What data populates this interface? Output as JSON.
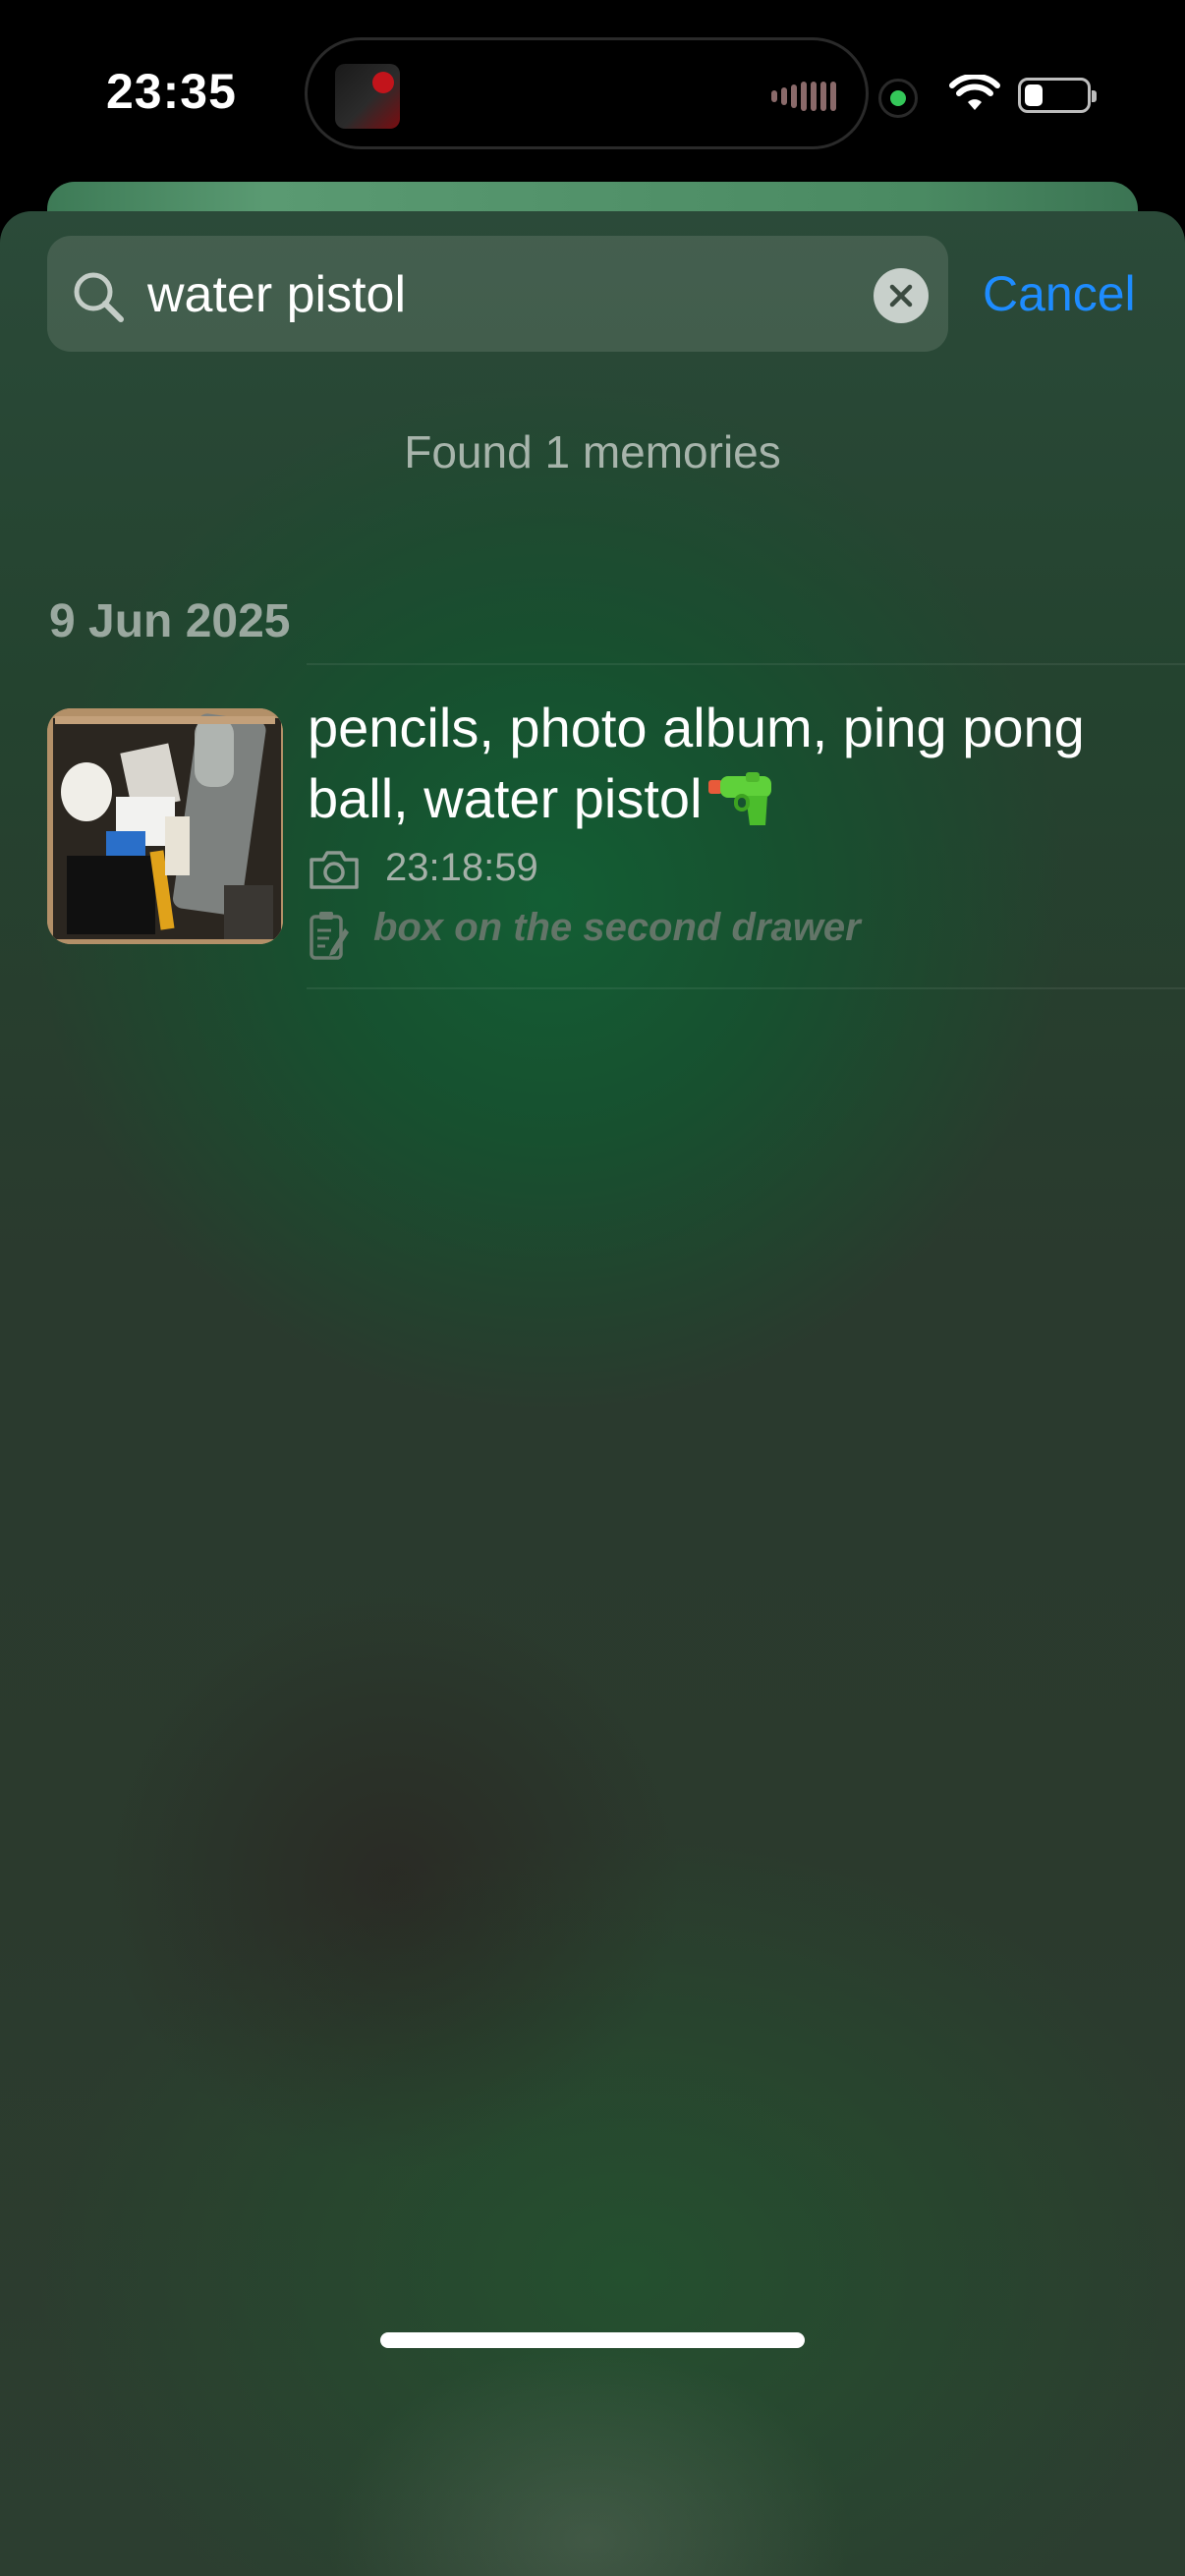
{
  "status_bar": {
    "time": "23:35"
  },
  "search": {
    "query": "water pistol",
    "cancel_label": "Cancel"
  },
  "results": {
    "summary": "Found 1 memories",
    "sections": [
      {
        "date": "9 Jun 2025",
        "items": [
          {
            "title": "pencils, photo album, ping pong ball, water pistol",
            "time": "23:18:59",
            "note": "box on the second drawer",
            "icons": [
              "water-pistol-emoji",
              "camera-icon",
              "note-icon"
            ]
          }
        ]
      }
    ]
  },
  "colors": {
    "accent": "#1e8cff",
    "recording_dot": "#34c759"
  }
}
